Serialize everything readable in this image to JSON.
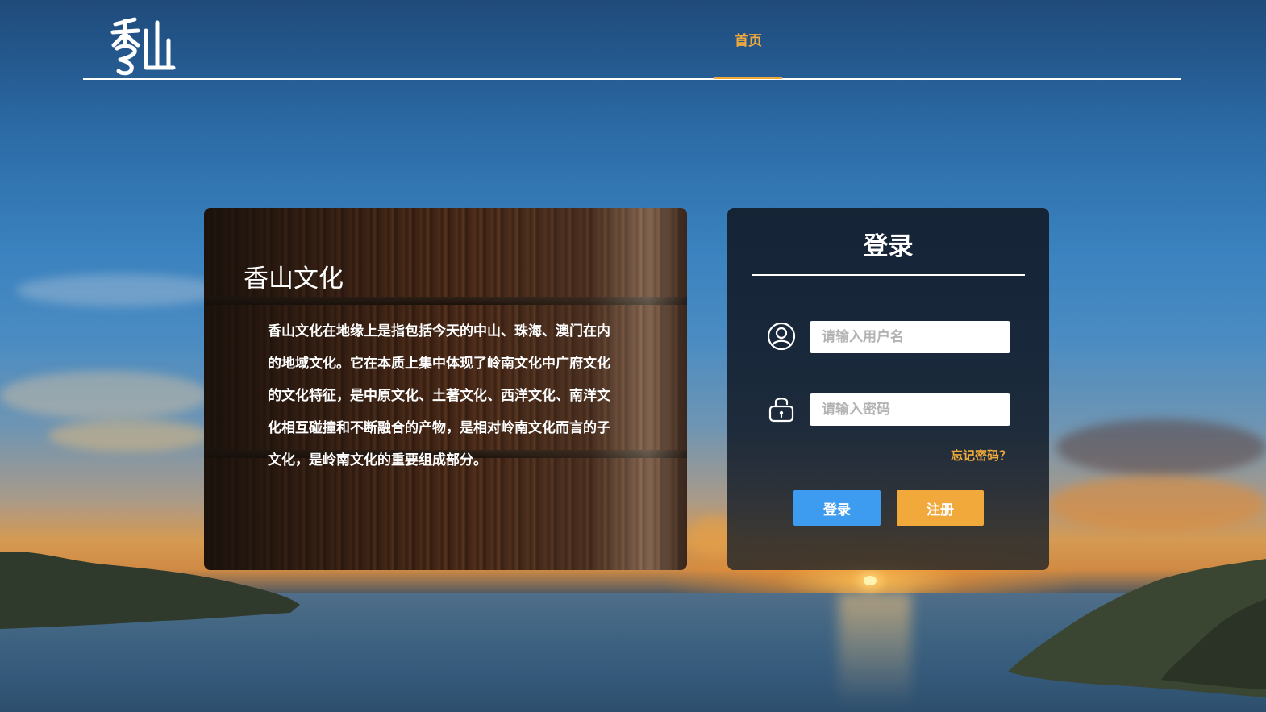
{
  "header": {
    "logo_text": "香山",
    "nav": [
      {
        "label": "首页",
        "active": true
      }
    ],
    "accent_color": "#f0a93a"
  },
  "intro": {
    "title": "香山文化",
    "body": "香山文化在地缘上是指包括今天的中山、珠海、澳门在内的地域文化。它在本质上集中体现了岭南文化中广府文化的文化特征，是中原文化、土著文化、西洋文化、南洋文化相互碰撞和不断融合的产物，是相对岭南文化而言的子文化，是岭南文化的重要组成部分。"
  },
  "login": {
    "title": "登录",
    "username": {
      "icon": "user-icon",
      "placeholder": "请输入用户名",
      "value": ""
    },
    "password": {
      "icon": "lock-icon",
      "placeholder": "请输入密码",
      "value": ""
    },
    "forgot_label": "忘记密码？",
    "login_button": "登录",
    "register_button": "注册",
    "login_color": "#3d9cf0",
    "register_color": "#f0a93a"
  }
}
